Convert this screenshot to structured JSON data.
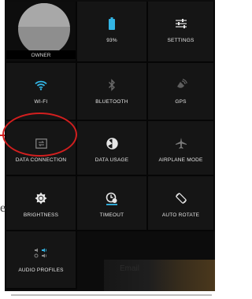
{
  "tiles": {
    "owner": {
      "label": "OWNER",
      "icon": "avatar-icon"
    },
    "battery": {
      "label": "93%",
      "icon": "battery-icon",
      "level": 0.93
    },
    "settings": {
      "label": "SETTINGS",
      "icon": "sliders-icon"
    },
    "wifi": {
      "label": "WI-FI",
      "icon": "wifi-icon"
    },
    "bluetooth": {
      "label": "BLUETOOTH",
      "icon": "bluetooth-icon"
    },
    "gps": {
      "label": "GPS",
      "icon": "gps-icon"
    },
    "data_connection": {
      "label": "DATA CONNECTION",
      "icon": "data-connection-icon"
    },
    "data_usage": {
      "label": "DATA USAGE",
      "icon": "data-usage-icon"
    },
    "airplane": {
      "label": "AIRPLANE MODE",
      "icon": "airplane-icon"
    },
    "brightness": {
      "label": "BRIGHTNESS",
      "icon": "brightness-icon"
    },
    "timeout": {
      "label": "TIMEOUT",
      "icon": "timeout-icon"
    },
    "auto_rotate": {
      "label": "AUTO ROTATE",
      "icon": "auto-rotate-icon"
    },
    "audio_profiles": {
      "label": "AUDIO PROFILES",
      "icon": "audio-profiles-icon"
    }
  },
  "background_text": {
    "email": "Email",
    "tail": "e"
  },
  "colors": {
    "accent": "#33b5e5",
    "annotation": "#d21f1f",
    "tile": "#151515"
  }
}
